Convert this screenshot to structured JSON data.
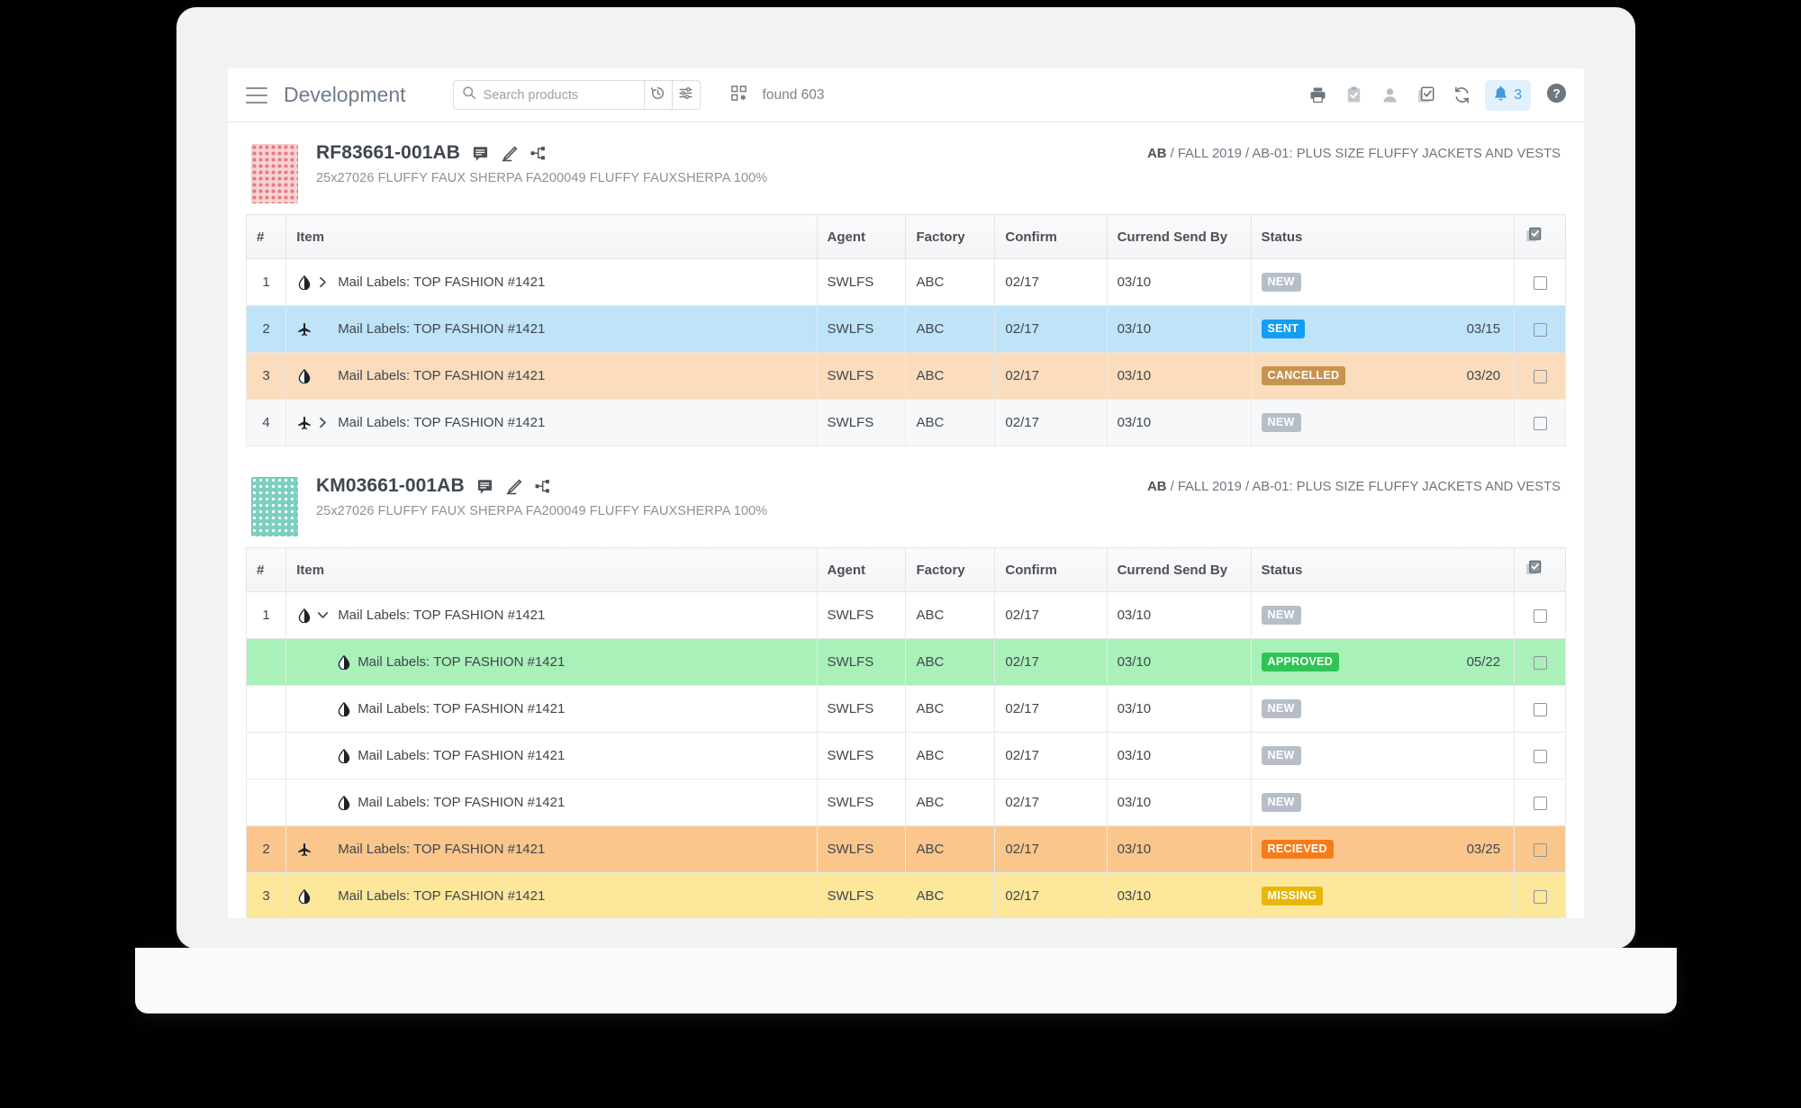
{
  "header": {
    "menu_icon": "hamburger-icon",
    "title": "Development",
    "search": {
      "placeholder": "Search products",
      "value": "",
      "icon": "search-icon"
    },
    "history_icon": "history-clock-icon",
    "filter_icon": "filter-sliders-icon",
    "grid_icon": "grid-view-icon",
    "found_text": "found 603",
    "actions": [
      {
        "name": "print-icon",
        "title": "Print"
      },
      {
        "name": "clipboard-check-icon",
        "title": "Tasks"
      },
      {
        "name": "user-icon",
        "title": "Account"
      },
      {
        "name": "copy-check-icon",
        "title": "Bulk select"
      },
      {
        "name": "refresh-icon",
        "title": "Refresh"
      }
    ],
    "notifications": {
      "icon": "bell-icon",
      "count": "3"
    },
    "help_icon": "help-icon"
  },
  "table": {
    "columns": [
      "#",
      "Item",
      "Agent",
      "Factory",
      "Confirm",
      "Currend Send By",
      "Status",
      ""
    ],
    "select_all_icon": "select-all-checkbox-icon"
  },
  "status_colors": {
    "NEW": "#b6bfc8",
    "SENT": "#119ef5",
    "CANCELLED": "#c79350",
    "APPROVED": "#31c455",
    "RECIEVED": "#f57c1b",
    "MISSING": "#e8b70a"
  },
  "cards": [
    {
      "code": "RF83661-001AB",
      "description": "25x27026 FLUFFY FAUX SHERPA FA200049 FLUFFY FAUXSHERPA 100%",
      "breadcrumb_strong": "AB",
      "breadcrumb_rest": " / FALL 2019 / AB-01: PLUS SIZE FLUFFY JACKETS AND VESTS",
      "thumb": "pink",
      "icons": [
        "comment-icon",
        "edit-pencil-icon",
        "branch-icon"
      ],
      "rows": [
        {
          "num": "1",
          "type": "droplet",
          "chevron": "right",
          "indent": false,
          "label": "Mail Labels: TOP FASHION #1421",
          "agent": "SWLFS",
          "factory": "ABC",
          "confirm": "02/17",
          "send_by": "03/10",
          "status": "NEW",
          "date": "",
          "tint": "r-white",
          "checked": false
        },
        {
          "num": "2",
          "type": "plane",
          "chevron": "none",
          "indent": false,
          "label": "Mail Labels: TOP FASHION #1421",
          "agent": "SWLFS",
          "factory": "ABC",
          "confirm": "02/17",
          "send_by": "03/10",
          "status": "SENT",
          "date": "03/15",
          "tint": "r-blue",
          "checked": false
        },
        {
          "num": "3",
          "type": "droplet",
          "chevron": "none",
          "indent": false,
          "label": "Mail Labels: TOP FASHION #1421",
          "agent": "SWLFS",
          "factory": "ABC",
          "confirm": "02/17",
          "send_by": "03/10",
          "status": "CANCELLED",
          "date": "03/20",
          "tint": "r-peach",
          "checked": false
        },
        {
          "num": "4",
          "type": "plane",
          "chevron": "right",
          "indent": false,
          "label": "Mail Labels: TOP FASHION #1421",
          "agent": "SWLFS",
          "factory": "ABC",
          "confirm": "02/17",
          "send_by": "03/10",
          "status": "NEW",
          "date": "",
          "tint": "r-grey",
          "checked": false
        }
      ]
    },
    {
      "code": "KM03661-001AB",
      "description": "25x27026 FLUFFY FAUX SHERPA FA200049 FLUFFY FAUXSHERPA 100%",
      "breadcrumb_strong": "AB",
      "breadcrumb_rest": " / FALL 2019 / AB-01: PLUS SIZE FLUFFY JACKETS AND VESTS",
      "thumb": "teal",
      "icons": [
        "comment-icon",
        "edit-pencil-icon",
        "branch-icon"
      ],
      "rows": [
        {
          "num": "1",
          "type": "droplet",
          "chevron": "down",
          "indent": false,
          "label": "Mail Labels: TOP FASHION #1421",
          "agent": "SWLFS",
          "factory": "ABC",
          "confirm": "02/17",
          "send_by": "03/10",
          "status": "NEW",
          "date": "",
          "tint": "r-white",
          "checked": false
        },
        {
          "num": "",
          "type": "droplet",
          "chevron": "none",
          "indent": true,
          "label": "Mail Labels: TOP FASHION #1421",
          "agent": "SWLFS",
          "factory": "ABC",
          "confirm": "02/17",
          "send_by": "03/10",
          "status": "APPROVED",
          "date": "05/22",
          "tint": "r-green",
          "checked": false
        },
        {
          "num": "",
          "type": "droplet",
          "chevron": "none",
          "indent": true,
          "label": "Mail Labels: TOP FASHION #1421",
          "agent": "SWLFS",
          "factory": "ABC",
          "confirm": "02/17",
          "send_by": "03/10",
          "status": "NEW",
          "date": "",
          "tint": "r-white",
          "checked": false
        },
        {
          "num": "",
          "type": "droplet",
          "chevron": "none",
          "indent": true,
          "label": "Mail Labels: TOP FASHION #1421",
          "agent": "SWLFS",
          "factory": "ABC",
          "confirm": "02/17",
          "send_by": "03/10",
          "status": "NEW",
          "date": "",
          "tint": "r-white",
          "checked": false
        },
        {
          "num": "",
          "type": "droplet",
          "chevron": "none",
          "indent": true,
          "label": "Mail Labels: TOP FASHION #1421",
          "agent": "SWLFS",
          "factory": "ABC",
          "confirm": "02/17",
          "send_by": "03/10",
          "status": "NEW",
          "date": "",
          "tint": "r-white",
          "checked": false
        },
        {
          "num": "2",
          "type": "plane",
          "chevron": "none",
          "indent": false,
          "label": "Mail Labels: TOP FASHION #1421",
          "agent": "SWLFS",
          "factory": "ABC",
          "confirm": "02/17",
          "send_by": "03/10",
          "status": "RECIEVED",
          "date": "03/25",
          "tint": "r-orange",
          "checked": false
        },
        {
          "num": "3",
          "type": "droplet",
          "chevron": "none",
          "indent": false,
          "label": "Mail Labels: TOP FASHION #1421",
          "agent": "SWLFS",
          "factory": "ABC",
          "confirm": "02/17",
          "send_by": "03/10",
          "status": "MISSING",
          "date": "",
          "tint": "r-yellow",
          "checked": false
        }
      ]
    }
  ]
}
